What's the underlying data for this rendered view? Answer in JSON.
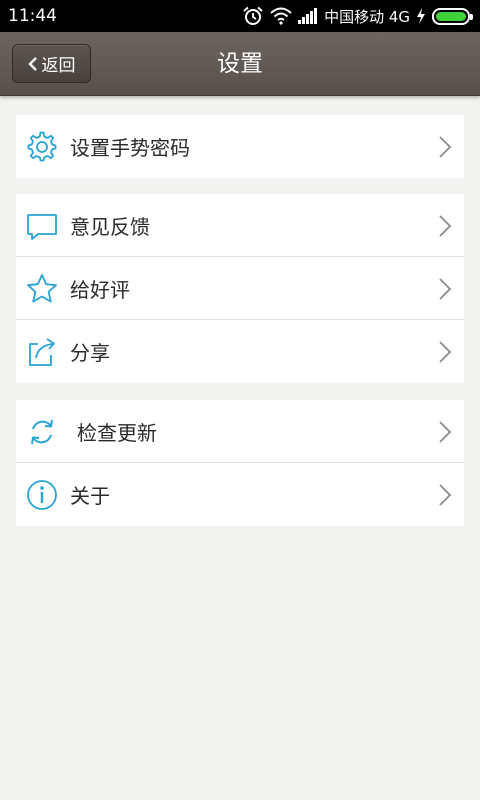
{
  "status_bar": {
    "time": "11:44",
    "carrier": "中国移动 4G",
    "battery_level": 1.0,
    "icons": [
      "alarm-icon",
      "wifi-icon",
      "signal-icon",
      "charging-icon",
      "battery-icon"
    ]
  },
  "header": {
    "back_label": "返回",
    "title": "设置"
  },
  "groups": [
    {
      "items": [
        {
          "label": "设置手势密码",
          "icon": "gear-icon"
        }
      ]
    },
    {
      "items": [
        {
          "label": "意见反馈",
          "icon": "speech-bubble-icon"
        },
        {
          "label": "给好评",
          "icon": "star-icon"
        },
        {
          "label": "分享",
          "icon": "share-icon"
        }
      ]
    },
    {
      "items": [
        {
          "label": "检查更新",
          "icon": "refresh-icon"
        },
        {
          "label": "关于",
          "icon": "info-icon"
        }
      ]
    }
  ],
  "colors": {
    "accent": "#29a3d3",
    "background": "#f2f2f0",
    "header": "#615a55"
  }
}
